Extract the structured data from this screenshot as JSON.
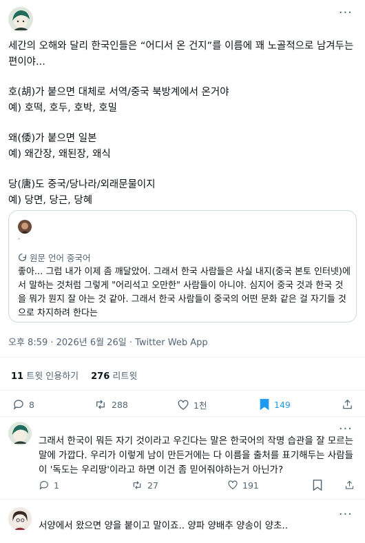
{
  "main_tweet": {
    "paragraphs": [
      [
        "세간의 오해와 달리 한국인들은 “어디서 온 건지”를 이름에 꽤 노골적으로 남겨두는 편이야..."
      ],
      [
        "호(胡)가 붙으면 대체로 서역/중국 북방계에서 온거야",
        "예) 호떡, 호두, 호박, 호밀"
      ],
      [
        "왜(倭)가 붙으면 일본",
        "예) 왜간장, 왜된장, 왜식"
      ],
      [
        "당(唐)도 중국/당나라/외래문물이지",
        "예) 당면, 당근, 당혜"
      ]
    ],
    "quote": {
      "translate_label": "원문 언어 중국어",
      "text": "좋아... 그럼 내가 이제 좀 깨달았어. 그래서 한국 사람들은 사실 내지(중국 본토 인터넷)에서 말하는 것처럼 그렇게 \"어리석고 오만한\" 사람들이 아니야. 심지어 중국 것과 한국 것을 뭐가 뭔지 잘 아는 것 같아. 그래서 한국 사람들이 중국의 어떤 문화 같은 걸 자기들 것으로 차지하려 한다는"
    },
    "meta": "오후 8:59 · 2026년 6월 26일 · Twitter Web App",
    "stats": {
      "quote_count": "11",
      "quote_label": "트윗 인용하기",
      "retweet_count": "276",
      "retweet_label": "리트윗"
    },
    "actions": {
      "replies": "8",
      "retweets": "288",
      "likes": "1천",
      "bookmarks": "149"
    }
  },
  "replies": [
    {
      "text": "그래서 한국이 뭐든 자기 것이라고 우긴다는 말은 한국어의 작명 습관을 잘 모르는 말에 가깝다. 우리가 이렇게 남이 만든거에는 다 이름을 출처를 표기해두는 사람들이 '독도는 우리땅'이라고 하면 이건 좀 믿어줘야하는거 아닌가?",
      "actions": {
        "replies": "1",
        "retweets": "27",
        "likes": "191"
      }
    },
    {
      "text": "서양에서 왔으면 양을 붙이고 말이죠.. 양파 양배추 양송이 양초.."
    }
  ],
  "colors": {
    "accent": "#1d9bf0",
    "muted": "#536471",
    "border": "#cfd9de",
    "divider": "#eff3f4"
  }
}
